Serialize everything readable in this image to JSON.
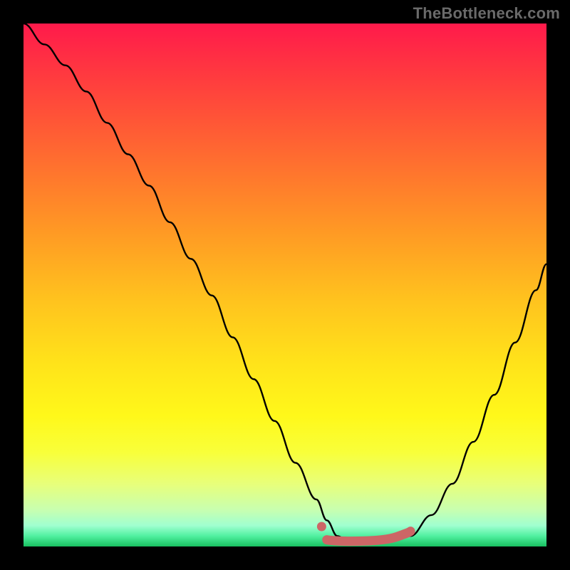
{
  "watermark": "TheBottleneck.com",
  "chart_data": {
    "type": "line",
    "title": "",
    "xlabel": "",
    "ylabel": "",
    "xlim": [
      0,
      100
    ],
    "ylim": [
      0,
      100
    ],
    "series": [
      {
        "name": "bottleneck-curve",
        "x": [
          0,
          4,
          8,
          12,
          16,
          20,
          24,
          28,
          32,
          36,
          40,
          44,
          48,
          52,
          56,
          58,
          60,
          62,
          66,
          70,
          74,
          78,
          82,
          86,
          90,
          94,
          98,
          100
        ],
        "y": [
          100,
          96,
          92,
          87,
          81,
          75,
          69,
          62,
          55,
          48,
          40,
          32,
          24,
          16,
          9,
          5,
          2,
          1,
          1,
          1,
          2,
          6,
          12,
          20,
          29,
          39,
          49,
          54
        ]
      }
    ],
    "optimal_marker": {
      "x": 57,
      "percent_y": 3
    },
    "optimal_band": {
      "x_start": 58,
      "x_end": 74,
      "percent_y": 1
    },
    "colors": {
      "curve": "#000000",
      "marker": "#cc6666",
      "gradient_top": "#ff1a4b",
      "gradient_bottom": "#18c060",
      "frame": "#000000"
    }
  }
}
